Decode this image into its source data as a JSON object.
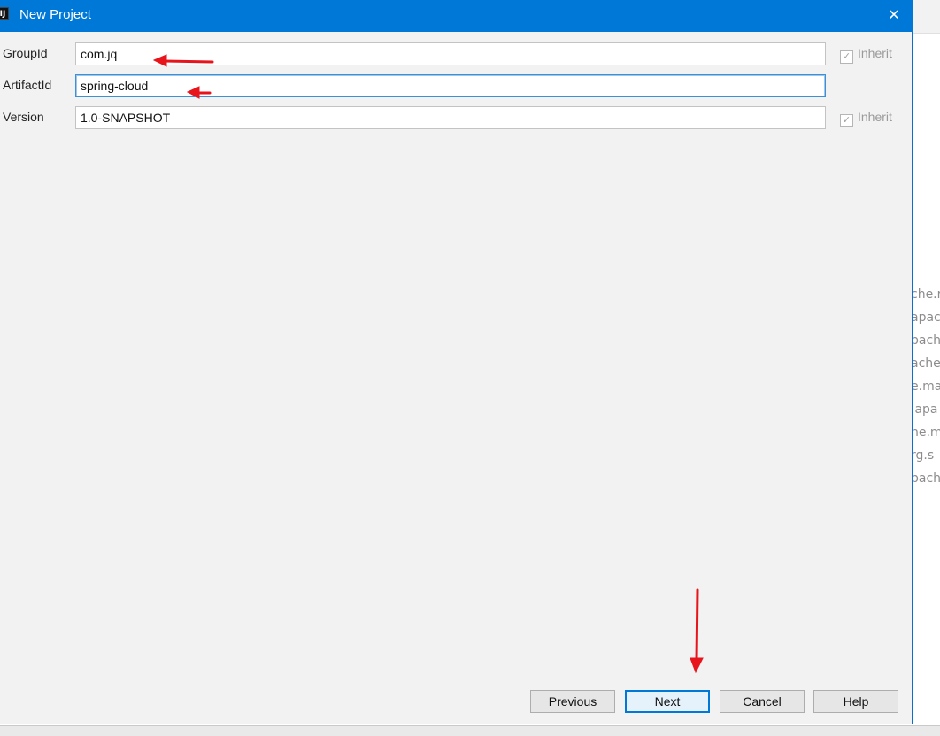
{
  "dialog": {
    "title": "New Project",
    "close_glyph": "✕",
    "app_icon_text": "IJ"
  },
  "form": {
    "group_id": {
      "label": "GroupId",
      "value": "com.jq",
      "inherit_label": "Inherit",
      "inherit_checked": true
    },
    "artifact_id": {
      "label": "ArtifactId",
      "value": "spring-cloud"
    },
    "version": {
      "label": "Version",
      "value": "1.0-SNAPSHOT",
      "inherit_label": "Inherit",
      "inherit_checked": true
    }
  },
  "buttons": {
    "previous": "Previous",
    "next": "Next",
    "cancel": "Cancel",
    "help": "Help"
  },
  "background_editor": {
    "lines": [
      "che.r",
      "apac",
      "pache",
      "ache.",
      "e.ma",
      ".apa",
      "he.m",
      "rg.s",
      "pach"
    ]
  },
  "colors": {
    "titlebar": "#0078d7",
    "dialog_bg": "#f2f2f2",
    "annotation_arrow": "#e8141b"
  }
}
